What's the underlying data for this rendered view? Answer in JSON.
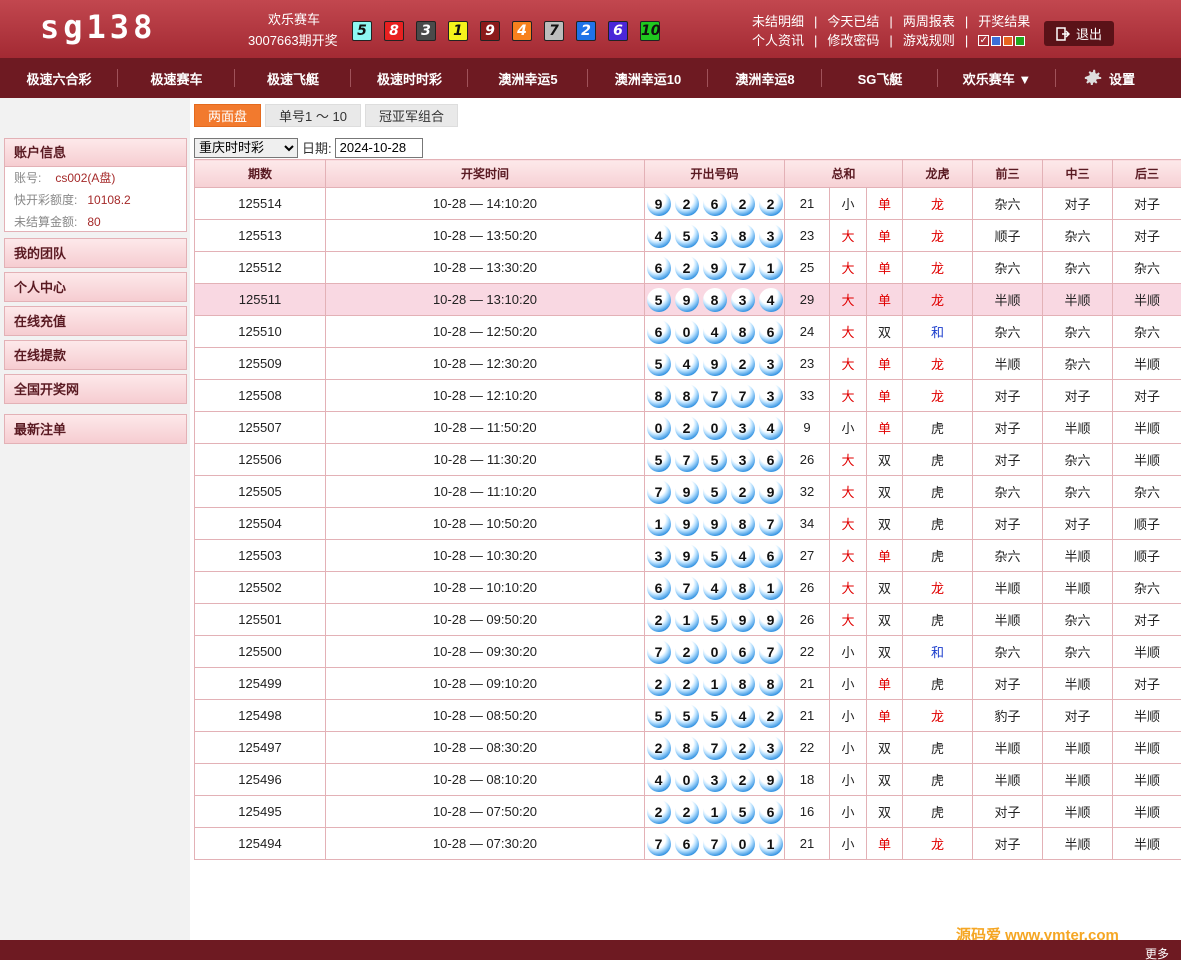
{
  "header": {
    "logo": "sg138",
    "game_name": "欢乐赛车",
    "issue_text": "3007663期开奖",
    "last_balls": [
      {
        "n": "5",
        "bg": "#8ef7f2"
      },
      {
        "n": "8",
        "bg": "#e82020"
      },
      {
        "n": "3",
        "bg": "#4a4a4a"
      },
      {
        "n": "1",
        "bg": "#f6f31c"
      },
      {
        "n": "9",
        "bg": "#8b1a1a"
      },
      {
        "n": "4",
        "bg": "#f7811e"
      },
      {
        "n": "7",
        "bg": "#bdbdbd"
      },
      {
        "n": "2",
        "bg": "#1f73e8"
      },
      {
        "n": "6",
        "bg": "#4a27d8"
      },
      {
        "n": "10",
        "bg": "#1fc81f"
      }
    ],
    "links_row1": [
      "未结明细",
      "今天已结",
      "两周报表",
      "开奖结果"
    ],
    "links_row2": [
      "个人资讯",
      "修改密码",
      "游戏规则"
    ],
    "palette": [
      "#3c6fd8",
      "#e8641e",
      "#1fa81f"
    ],
    "logout": "退出"
  },
  "nav": {
    "items": [
      "极速六合彩",
      "极速赛车",
      "极速飞艇",
      "极速时时彩",
      "澳洲幸运5",
      "澳洲幸运10",
      "澳洲幸运8",
      "SG飞艇",
      "欢乐赛车 ▼"
    ],
    "settings": "设置"
  },
  "sidebar": {
    "account_title": "账户信息",
    "account": [
      {
        "k": "账号:",
        "v": "cs002(A盘)"
      },
      {
        "k": "快开彩额度:",
        "v": "10108.2"
      },
      {
        "k": "未结算金额:",
        "v": "80"
      }
    ],
    "items": [
      "我的团队",
      "个人中心",
      "在线充值",
      "在线提款",
      "全国开奖网"
    ],
    "latest": "最新注单"
  },
  "tabs": [
    "两面盘",
    "单号1 ～ 10",
    "冠亚军组合"
  ],
  "filter": {
    "lottery": "重庆时时彩",
    "date_label": "日期:",
    "date": "2024-10-28"
  },
  "table": {
    "headers": [
      "期数",
      "开奖时间",
      "开出号码",
      "总和",
      "龙虎",
      "前三",
      "中三",
      "后三"
    ],
    "rows": [
      {
        "issue": "125514",
        "time": "10-28 — 14:10:20",
        "balls": [
          9,
          2,
          6,
          2,
          2
        ],
        "sum": "21",
        "size": "小",
        "parity": "单",
        "dt": "龙",
        "front": "杂六",
        "middle": "对子",
        "back": "对子"
      },
      {
        "issue": "125513",
        "time": "10-28 — 13:50:20",
        "balls": [
          4,
          5,
          3,
          8,
          3
        ],
        "sum": "23",
        "size": "大",
        "parity": "单",
        "dt": "龙",
        "front": "顺子",
        "middle": "杂六",
        "back": "对子"
      },
      {
        "issue": "125512",
        "time": "10-28 — 13:30:20",
        "balls": [
          6,
          2,
          9,
          7,
          1
        ],
        "sum": "25",
        "size": "大",
        "parity": "单",
        "dt": "龙",
        "front": "杂六",
        "middle": "杂六",
        "back": "杂六"
      },
      {
        "issue": "125511",
        "time": "10-28 — 13:10:20",
        "balls": [
          5,
          9,
          8,
          3,
          4
        ],
        "sum": "29",
        "size": "大",
        "parity": "单",
        "dt": "龙",
        "front": "半顺",
        "middle": "半顺",
        "back": "半顺"
      },
      {
        "issue": "125510",
        "time": "10-28 — 12:50:20",
        "balls": [
          6,
          0,
          4,
          8,
          6
        ],
        "sum": "24",
        "size": "大",
        "parity": "双",
        "dt": "和",
        "front": "杂六",
        "middle": "杂六",
        "back": "杂六"
      },
      {
        "issue": "125509",
        "time": "10-28 — 12:30:20",
        "balls": [
          5,
          4,
          9,
          2,
          3
        ],
        "sum": "23",
        "size": "大",
        "parity": "单",
        "dt": "龙",
        "front": "半顺",
        "middle": "杂六",
        "back": "半顺"
      },
      {
        "issue": "125508",
        "time": "10-28 — 12:10:20",
        "balls": [
          8,
          8,
          7,
          7,
          3
        ],
        "sum": "33",
        "size": "大",
        "parity": "单",
        "dt": "龙",
        "front": "对子",
        "middle": "对子",
        "back": "对子"
      },
      {
        "issue": "125507",
        "time": "10-28 — 11:50:20",
        "balls": [
          0,
          2,
          0,
          3,
          4
        ],
        "sum": "9",
        "size": "小",
        "parity": "单",
        "dt": "虎",
        "front": "对子",
        "middle": "半顺",
        "back": "半顺"
      },
      {
        "issue": "125506",
        "time": "10-28 — 11:30:20",
        "balls": [
          5,
          7,
          5,
          3,
          6
        ],
        "sum": "26",
        "size": "大",
        "parity": "双",
        "dt": "虎",
        "front": "对子",
        "middle": "杂六",
        "back": "半顺"
      },
      {
        "issue": "125505",
        "time": "10-28 — 11:10:20",
        "balls": [
          7,
          9,
          5,
          2,
          9
        ],
        "sum": "32",
        "size": "大",
        "parity": "双",
        "dt": "虎",
        "front": "杂六",
        "middle": "杂六",
        "back": "杂六"
      },
      {
        "issue": "125504",
        "time": "10-28 — 10:50:20",
        "balls": [
          1,
          9,
          9,
          8,
          7
        ],
        "sum": "34",
        "size": "大",
        "parity": "双",
        "dt": "虎",
        "front": "对子",
        "middle": "对子",
        "back": "顺子"
      },
      {
        "issue": "125503",
        "time": "10-28 — 10:30:20",
        "balls": [
          3,
          9,
          5,
          4,
          6
        ],
        "sum": "27",
        "size": "大",
        "parity": "单",
        "dt": "虎",
        "front": "杂六",
        "middle": "半顺",
        "back": "顺子"
      },
      {
        "issue": "125502",
        "time": "10-28 — 10:10:20",
        "balls": [
          6,
          7,
          4,
          8,
          1
        ],
        "sum": "26",
        "size": "大",
        "parity": "双",
        "dt": "龙",
        "front": "半顺",
        "middle": "半顺",
        "back": "杂六"
      },
      {
        "issue": "125501",
        "time": "10-28 — 09:50:20",
        "balls": [
          2,
          1,
          5,
          9,
          9
        ],
        "sum": "26",
        "size": "大",
        "parity": "双",
        "dt": "虎",
        "front": "半顺",
        "middle": "杂六",
        "back": "对子"
      },
      {
        "issue": "125500",
        "time": "10-28 — 09:30:20",
        "balls": [
          7,
          2,
          0,
          6,
          7
        ],
        "sum": "22",
        "size": "小",
        "parity": "双",
        "dt": "和",
        "front": "杂六",
        "middle": "杂六",
        "back": "半顺"
      },
      {
        "issue": "125499",
        "time": "10-28 — 09:10:20",
        "balls": [
          2,
          2,
          1,
          8,
          8
        ],
        "sum": "21",
        "size": "小",
        "parity": "单",
        "dt": "虎",
        "front": "对子",
        "middle": "半顺",
        "back": "对子"
      },
      {
        "issue": "125498",
        "time": "10-28 — 08:50:20",
        "balls": [
          5,
          5,
          5,
          4,
          2
        ],
        "sum": "21",
        "size": "小",
        "parity": "单",
        "dt": "龙",
        "front": "豹子",
        "middle": "对子",
        "back": "半顺"
      },
      {
        "issue": "125497",
        "time": "10-28 — 08:30:20",
        "balls": [
          2,
          8,
          7,
          2,
          3
        ],
        "sum": "22",
        "size": "小",
        "parity": "双",
        "dt": "虎",
        "front": "半顺",
        "middle": "半顺",
        "back": "半顺"
      },
      {
        "issue": "125496",
        "time": "10-28 — 08:10:20",
        "balls": [
          4,
          0,
          3,
          2,
          9
        ],
        "sum": "18",
        "size": "小",
        "parity": "双",
        "dt": "虎",
        "front": "半顺",
        "middle": "半顺",
        "back": "半顺"
      },
      {
        "issue": "125495",
        "time": "10-28 — 07:50:20",
        "balls": [
          2,
          2,
          1,
          5,
          6
        ],
        "sum": "16",
        "size": "小",
        "parity": "双",
        "dt": "虎",
        "front": "对子",
        "middle": "半顺",
        "back": "半顺"
      },
      {
        "issue": "125494",
        "time": "10-28 — 07:30:20",
        "balls": [
          7,
          6,
          7,
          0,
          1
        ],
        "sum": "21",
        "size": "小",
        "parity": "单",
        "dt": "龙",
        "front": "对子",
        "middle": "半顺",
        "back": "半顺"
      }
    ]
  },
  "footer": {
    "more": "更多",
    "watermark": "源码爱 www.ymter.com"
  },
  "colors": {
    "header": "#b03540",
    "nav": "#6e1a22",
    "accent_tab": "#f27a2e",
    "highlight_row": "#f9d8e2",
    "red_text": "#e00000",
    "blue_text": "#1a3ccc"
  }
}
